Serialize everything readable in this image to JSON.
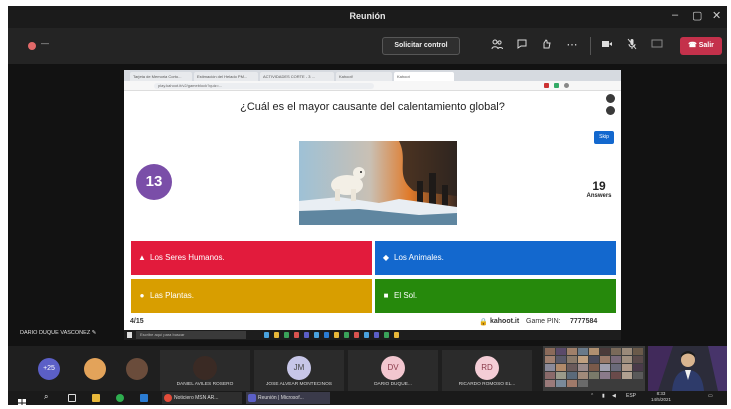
{
  "window": {
    "title": "Reunión",
    "controls": {
      "minimize": "–",
      "maximize": "▢",
      "close": "✕"
    }
  },
  "toolbar": {
    "timer": "—",
    "control_button": "Solicitar control",
    "leave_button": "Salir",
    "icons": [
      "people-icon",
      "chat-icon",
      "reactions-icon",
      "more-icon",
      "camera-icon",
      "mic-off-icon",
      "share-icon"
    ]
  },
  "browser": {
    "tabs": [
      "Tarjeta de Memoria Corto...",
      "Estimación del Helado PM...",
      "ACTIVIDADES CORTE - 3 ...",
      "Kahoot!",
      "Kahoot"
    ],
    "url": "play.kahoot.it/v2/gameblock?quiz=..."
  },
  "kahoot": {
    "question": "¿Cuál es el mayor causante del calentamiento global?",
    "skip": "Skip",
    "timer_value": "13",
    "answers_count": "19",
    "answers_label": "Answers",
    "options": [
      {
        "label": "Los Seres Humanos.",
        "shape": "triangle",
        "color": "#e21b3c"
      },
      {
        "label": "Los Animales.",
        "shape": "diamond",
        "color": "#1368ce"
      },
      {
        "label": "Las Plantas.",
        "shape": "circle",
        "color": "#d89e00"
      },
      {
        "label": "El Sol.",
        "shape": "square",
        "color": "#26890c"
      }
    ],
    "progress": "4/15",
    "brand": "kahoot.it",
    "game_pin_label": "Game PIN:",
    "game_pin": "7777584"
  },
  "inner_taskbar": {
    "search_placeholder": "Escribe aquí para buscar"
  },
  "sharer": {
    "name": "DARIO DUQUE VASCONEZ"
  },
  "participants": {
    "overflow": "+25",
    "tiles": [
      {
        "name": "DANIEL AVILES ROSERO",
        "initials": "",
        "color": "#3a2a24"
      },
      {
        "name": "JOSE ALVEAR MONTECINOS",
        "initials": "JM",
        "color": "#c7c6e8"
      },
      {
        "name": "DARIO DUQUE...",
        "initials": "DV",
        "color": "#f2c6cf"
      },
      {
        "name": "RICARDO ROMOSO EL...",
        "initials": "RD",
        "color": "#f4cdd6"
      }
    ]
  },
  "windows_taskbar": {
    "apps": [
      "Noticiero MSN AR...",
      "Reunión | Microsof..."
    ],
    "language": "ESP",
    "time": "8:33",
    "date": "14/5/2021"
  },
  "colors": {
    "teams_dark": "#1f1f1f",
    "leave_red": "#c4314b",
    "kahoot_purple": "#7a4ea8",
    "kahoot_blue": "#1368ce"
  }
}
